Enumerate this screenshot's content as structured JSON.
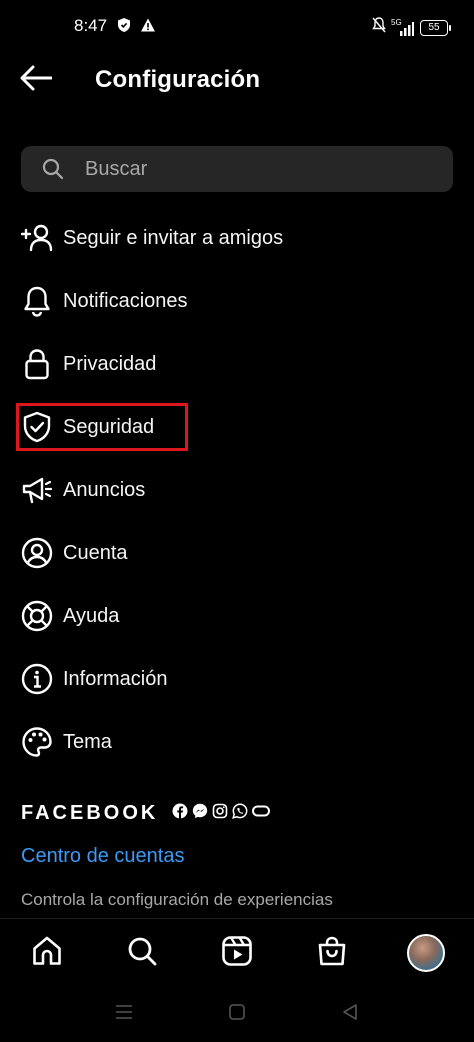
{
  "status_bar": {
    "time": "8:47",
    "network": "5G",
    "battery": "55"
  },
  "header": {
    "title": "Configuración",
    "back_icon": "arrow-left-icon"
  },
  "search": {
    "placeholder": "Buscar",
    "value": ""
  },
  "menu": {
    "items": [
      {
        "label": "Seguir e invitar a amigos",
        "icon": "add-person-icon"
      },
      {
        "label": "Notificaciones",
        "icon": "bell-icon"
      },
      {
        "label": "Privacidad",
        "icon": "lock-icon"
      },
      {
        "label": "Seguridad",
        "icon": "shield-check-icon"
      },
      {
        "label": "Anuncios",
        "icon": "megaphone-icon"
      },
      {
        "label": "Cuenta",
        "icon": "user-circle-icon"
      },
      {
        "label": "Ayuda",
        "icon": "lifebuoy-icon"
      },
      {
        "label": "Información",
        "icon": "info-icon"
      },
      {
        "label": "Tema",
        "icon": "palette-icon"
      }
    ],
    "highlighted": "Seguridad",
    "highlight_color": "#e0161f"
  },
  "facebook": {
    "brand": "FACEBOOK",
    "accounts_link": "Centro de cuentas",
    "accounts_desc": "Controla la configuración de experiencias",
    "link_color": "#3b9af5"
  },
  "bottom_nav": {
    "items": [
      "home-icon",
      "search-icon",
      "reels-icon",
      "shop-icon",
      "profile-avatar"
    ]
  },
  "system_nav": {
    "items": [
      "recents-icon",
      "home-square-icon",
      "back-triangle-icon"
    ]
  }
}
